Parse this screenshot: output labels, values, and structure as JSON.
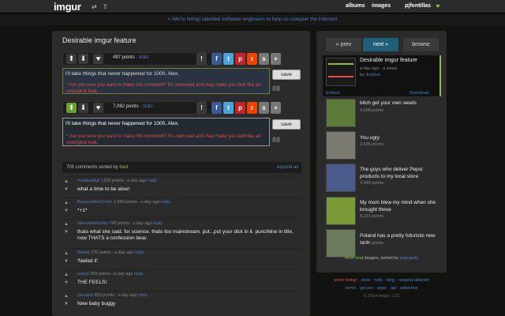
{
  "header": {
    "logo": "imgur",
    "nav": [
      "albums",
      "images",
      "pjfontillas"
    ]
  },
  "banner": "» We're hiring! talented software engineers to help us conquer the internet!",
  "post": {
    "title": "Desirable imgur feature"
  },
  "vote1": {
    "points": "497 points",
    "stats": "stats"
  },
  "vote2": {
    "points": "7,082 points",
    "stats": "stats"
  },
  "comment_box1": {
    "text": "I'll take things that never happened for 1000, Alex.",
    "warning": "* Are you sure you want to make this comment? It's overused and may make you look like an unoriginal twat.",
    "save": "save",
    "count": "88"
  },
  "comment_box2": {
    "text": "I'll take things that never happened for 1000, Alex.",
    "warning": "* Are you sure you want to make this comment? It's overused and may make you look like an unoriginal twat.",
    "save": "save",
    "count": "88"
  },
  "comments_header": {
    "count": "705 comments sorted by",
    "sort": "best",
    "expand": "expand all"
  },
  "comments": [
    {
      "user": "moistvoidyk",
      "meta": "1200 points : a day ago",
      "reply": "reply",
      "text": "what a time to be alive!"
    },
    {
      "user": "BanjoesAreComin",
      "meta": "1,590 points : a day ago",
      "reply": "reply",
      "text": "*+1*"
    },
    {
      "user": "lakeseidehunter",
      "meta": "740 points : a day ago",
      "reply": "reply",
      "text": "thats what she said. for science. thats too mainstream. put...put your dick in it. punchline in title. now THATS a confession bear."
    },
    {
      "user": "Bidark",
      "meta": "270 points : a day ago",
      "reply": "reply",
      "text": "'Nailed it'"
    },
    {
      "user": "crazyt",
      "meta": "260 points : a day ago",
      "reply": "reply",
      "text": "THE FEELS!"
    },
    {
      "user": "yesoline",
      "meta": "652 points : a day ago",
      "reply": "reply",
      "text": "New baby buggy"
    }
  ],
  "sidebar": {
    "prev": "« prev",
    "next": "next »",
    "browse": "browse",
    "current": {
      "title": "Desirable imgur feature",
      "meta": "a day ago",
      "views": "· a views",
      "by": "by",
      "author": "dcalltax",
      "embed": "Embed",
      "download": "Download"
    },
    "items": [
      {
        "title": "bitch get your own seeds",
        "points": "4,698 points"
      },
      {
        "title": "You ugly.",
        "points": "2,636 points"
      },
      {
        "title": "The guys who deliver Pepsi products to my local store",
        "points": "4,045 points"
      },
      {
        "title": "My mom blew my mind when she brought these",
        "points": "5,221 points"
      },
      {
        "title": "Poland has a pretty futuristic new tank",
        "points": "5,183 points"
      }
    ],
    "viral": "most viral",
    "viral2": "images, sorted by",
    "popularity": "popularity"
  },
  "footer": {
    "hiring": "we're hiring!",
    "links1": "· store · help · blog · request deletion",
    "links2": "terms · get pro · apps · api · advertise",
    "copyright": "© 2014 imgur, LLC"
  }
}
